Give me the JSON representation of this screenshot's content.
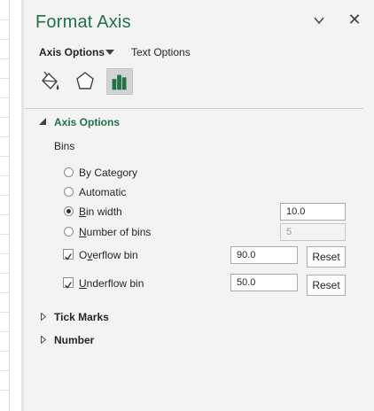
{
  "pane": {
    "title": "Format Axis",
    "accent_color": "#217346",
    "options_dropdown_icon": "chevron-down-icon",
    "close_glyph": "✕"
  },
  "tabs": {
    "axis_options": "Axis Options",
    "text_options": "Text Options"
  },
  "icon_tabs": [
    "fill-line-icon",
    "effects-pentagon-icon",
    "axis-options-bar-chart-icon"
  ],
  "sections": {
    "axis_options": "Axis Options",
    "tick_marks": "Tick Marks",
    "number": "Number"
  },
  "bins": {
    "heading": "Bins",
    "by_category_prefix": "By Cate",
    "by_category_u": "g",
    "by_category_suffix": "ory",
    "automatic": "Automatic",
    "bin_width_u": "B",
    "bin_width_rest": "in width",
    "bin_width_value": "10.0",
    "number_of_bins_u": "N",
    "number_of_bins_rest": "umber of bins",
    "number_of_bins_value": "5",
    "overflow_pre": "O",
    "overflow_u": "v",
    "overflow_rest": "erflow bin",
    "overflow_value": "90.0",
    "underflow_u": "U",
    "underflow_rest": "nderflow bin",
    "underflow_value": "50.0",
    "reset_label": "Reset"
  }
}
